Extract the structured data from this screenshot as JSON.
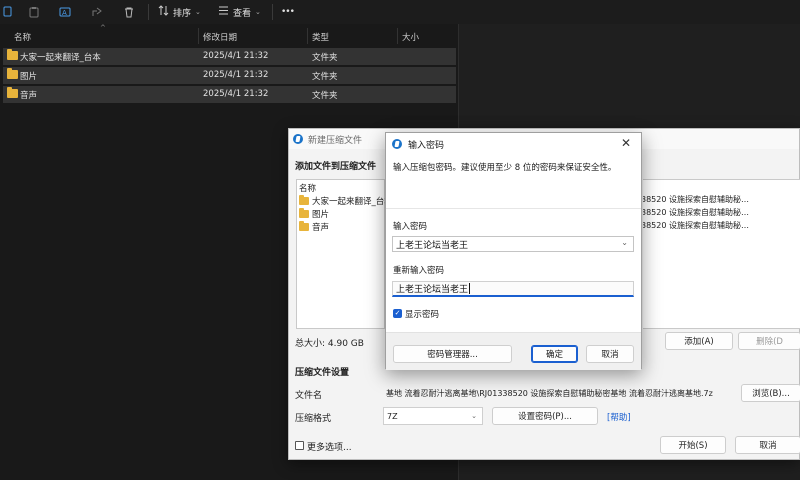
{
  "toolbar": {
    "sort_label": "排序",
    "view_label": "查看",
    "more_label": "•••"
  },
  "filelist": {
    "headers": {
      "name": "名称",
      "date": "修改日期",
      "type": "类型",
      "size": "大小"
    },
    "rows": [
      {
        "name": "大家一起来翻译_台本",
        "date": "2025/4/1 21:32",
        "type": "文件夹"
      },
      {
        "name": "图片",
        "date": "2025/4/1 21:32",
        "type": "文件夹"
      },
      {
        "name": "音声",
        "date": "2025/4/1 21:32",
        "type": "文件夹"
      }
    ]
  },
  "zip_dialog": {
    "title": "新建压缩文件",
    "add_files_label": "添加文件到压缩文件",
    "list_header": "名称",
    "list_items": [
      "大家一起来翻译_台本",
      "图片",
      "音声"
    ],
    "list_right_lines": [
      "38520 设施探索自慰辅助秘…",
      "38520 设施探索自慰辅助秘…",
      "38520 设施探索自慰辅助秘…"
    ],
    "total_size": "总大小: 4.90 GB",
    "add_button": "添加(A)",
    "delete_button": "删除(D",
    "settings_heading": "压缩文件设置",
    "filename_label": "文件名",
    "filename_value": "基地 流着忍耐汁逃离基地\\RJ01338520 设施探索自慰辅助秘密基地 流着忍耐汁逃离基地.7z",
    "browse_button": "浏览(B)...",
    "format_label": "压缩格式",
    "format_value": "7Z",
    "set_password_button": "设置密码(P)...",
    "help_link": "[帮助]",
    "more_options_label": "更多选项...",
    "start_button": "开始(S)",
    "cancel_button": "取消"
  },
  "password_dialog": {
    "title": "输入密码",
    "close_glyph": "✕",
    "instruction": "输入压缩包密码。建议使用至少 8 位的密码来保证安全性。",
    "password_label": "输入密码",
    "password_value": "上老王论坛当老王",
    "confirm_label": "重新输入密码",
    "confirm_value": "上老王论坛当老王",
    "show_password_label": "显示密码",
    "show_password_checked": true,
    "manager_button": "密码管理器...",
    "ok_button": "确定",
    "cancel_button": "取消"
  },
  "colors": {
    "accent": "#1a5fd0",
    "folder": "#e8b43b",
    "explorer_bg": "#191919",
    "selected_row": "#333333"
  }
}
